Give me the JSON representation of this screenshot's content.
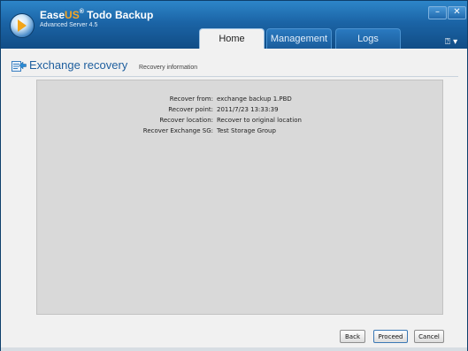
{
  "app": {
    "brand_ease": "Ease",
    "brand_us": "US",
    "brand_mark": "®",
    "brand_rest": " Todo Backup",
    "edition": "Advanced Server 4.5"
  },
  "window_controls": {
    "minimize": "–",
    "close": "✕"
  },
  "tabs": [
    {
      "label": "Home",
      "active": true
    },
    {
      "label": "Management",
      "active": false
    },
    {
      "label": "Logs",
      "active": false
    }
  ],
  "help": {
    "label": "⍰ ▾"
  },
  "page": {
    "title": "Exchange recovery",
    "subtitle": "Recovery information"
  },
  "details": [
    {
      "label": "Recover from:",
      "value": "exchange backup 1.PBD"
    },
    {
      "label": "Recover point:",
      "value": "2011/7/23 13:33:39"
    },
    {
      "label": "Recover location:",
      "value": "Recover to original location"
    },
    {
      "label": "Recover Exchange SG:",
      "value": "Test Storage Group"
    }
  ],
  "buttons": {
    "back": "Back",
    "proceed": "Proceed",
    "cancel": "Cancel"
  }
}
